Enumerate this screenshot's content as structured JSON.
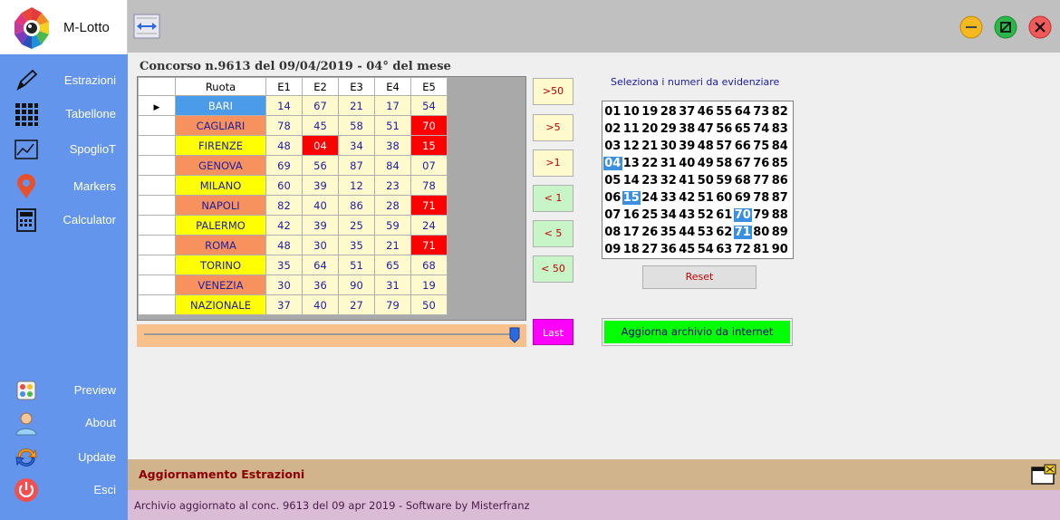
{
  "app": {
    "title": "M-Lotto"
  },
  "sidebar": {
    "items": [
      {
        "label": "Estrazioni",
        "icon": "pencil-icon"
      },
      {
        "label": "Tabellone",
        "icon": "grid-icon"
      },
      {
        "label": "SpoglioT",
        "icon": "chart-icon"
      },
      {
        "label": "Markers",
        "icon": "map-pin-icon"
      },
      {
        "label": "Calculator",
        "icon": "calculator-icon"
      }
    ],
    "bottom_items": [
      {
        "label": "Preview",
        "icon": "preview-icon"
      },
      {
        "label": "About",
        "icon": "user-icon"
      },
      {
        "label": "Update",
        "icon": "refresh-icon"
      },
      {
        "label": "Esci",
        "icon": "power-icon"
      }
    ]
  },
  "colors": {
    "sidebar": "#6495ed",
    "red_cell": "#ff0000",
    "highlight": "#3a8fe0",
    "blue_row": "#4a9bea",
    "orange_row": "#f7925f",
    "yellow_row": "#ffff00"
  },
  "header": {
    "concorso": "Concorso n.9613 del 09/04/2019 - 04° del mese"
  },
  "grid": {
    "columns": [
      "Ruota",
      "E1",
      "E2",
      "E3",
      "E4",
      "E5"
    ],
    "rows": [
      {
        "ruota": "BARI",
        "color": "blue",
        "values": [
          "14",
          "67",
          "21",
          "17",
          "54"
        ],
        "red": []
      },
      {
        "ruota": "CAGLIARI",
        "color": "orange",
        "values": [
          "78",
          "45",
          "58",
          "51",
          "70"
        ],
        "red": [
          4
        ]
      },
      {
        "ruota": "FIRENZE",
        "color": "yellow",
        "values": [
          "48",
          "04",
          "34",
          "38",
          "15"
        ],
        "red": [
          1,
          4
        ]
      },
      {
        "ruota": "GENOVA",
        "color": "orange",
        "values": [
          "69",
          "56",
          "87",
          "84",
          "07"
        ],
        "red": []
      },
      {
        "ruota": "MILANO",
        "color": "yellow",
        "values": [
          "60",
          "39",
          "12",
          "23",
          "78"
        ],
        "red": []
      },
      {
        "ruota": "NAPOLI",
        "color": "orange",
        "values": [
          "82",
          "40",
          "86",
          "28",
          "71"
        ],
        "red": [
          4
        ]
      },
      {
        "ruota": "PALERMO",
        "color": "yellow",
        "values": [
          "42",
          "39",
          "25",
          "59",
          "24"
        ],
        "red": []
      },
      {
        "ruota": "ROMA",
        "color": "orange",
        "values": [
          "48",
          "30",
          "35",
          "21",
          "71"
        ],
        "red": [
          4
        ]
      },
      {
        "ruota": "TORINO",
        "color": "yellow",
        "values": [
          "35",
          "64",
          "51",
          "65",
          "68"
        ],
        "red": []
      },
      {
        "ruota": "VENEZIA",
        "color": "orange",
        "values": [
          "30",
          "36",
          "90",
          "31",
          "19"
        ],
        "red": []
      },
      {
        "ruota": "NAZIONALE",
        "color": "yellow",
        "values": [
          "37",
          "40",
          "27",
          "79",
          "50"
        ],
        "red": []
      }
    ]
  },
  "filters": {
    "buttons": [
      ">50",
      ">5",
      ">1",
      "< 1",
      "< 5",
      "< 50"
    ],
    "last": "Last"
  },
  "selector": {
    "title": "Seleziona i numeri da evidenziare",
    "rows": [
      [
        "01",
        "10",
        "19",
        "28",
        "37",
        "46",
        "55",
        "64",
        "73",
        "82"
      ],
      [
        "02",
        "11",
        "20",
        "29",
        "38",
        "47",
        "56",
        "65",
        "74",
        "83"
      ],
      [
        "03",
        "12",
        "21",
        "30",
        "39",
        "48",
        "57",
        "66",
        "75",
        "84"
      ],
      [
        "04",
        "13",
        "22",
        "31",
        "40",
        "49",
        "58",
        "67",
        "76",
        "85"
      ],
      [
        "05",
        "14",
        "23",
        "32",
        "41",
        "50",
        "59",
        "68",
        "77",
        "86"
      ],
      [
        "06",
        "15",
        "24",
        "33",
        "42",
        "51",
        "60",
        "69",
        "78",
        "87"
      ],
      [
        "07",
        "16",
        "25",
        "34",
        "43",
        "52",
        "61",
        "70",
        "79",
        "88"
      ],
      [
        "08",
        "17",
        "26",
        "35",
        "44",
        "53",
        "62",
        "71",
        "80",
        "89"
      ],
      [
        "09",
        "18",
        "27",
        "36",
        "45",
        "54",
        "63",
        "72",
        "81",
        "90"
      ]
    ],
    "highlighted": [
      "04",
      "15",
      "70",
      "71"
    ],
    "reset": "Reset",
    "update": "Aggiorna archivio da internet"
  },
  "slider": {
    "value_fraction": 1.0
  },
  "status": {
    "section": "Aggiornamento Estrazioni",
    "footer": "Archivio aggiornato al conc. 9613 del 09 apr 2019 - Software by Misterfranz"
  }
}
